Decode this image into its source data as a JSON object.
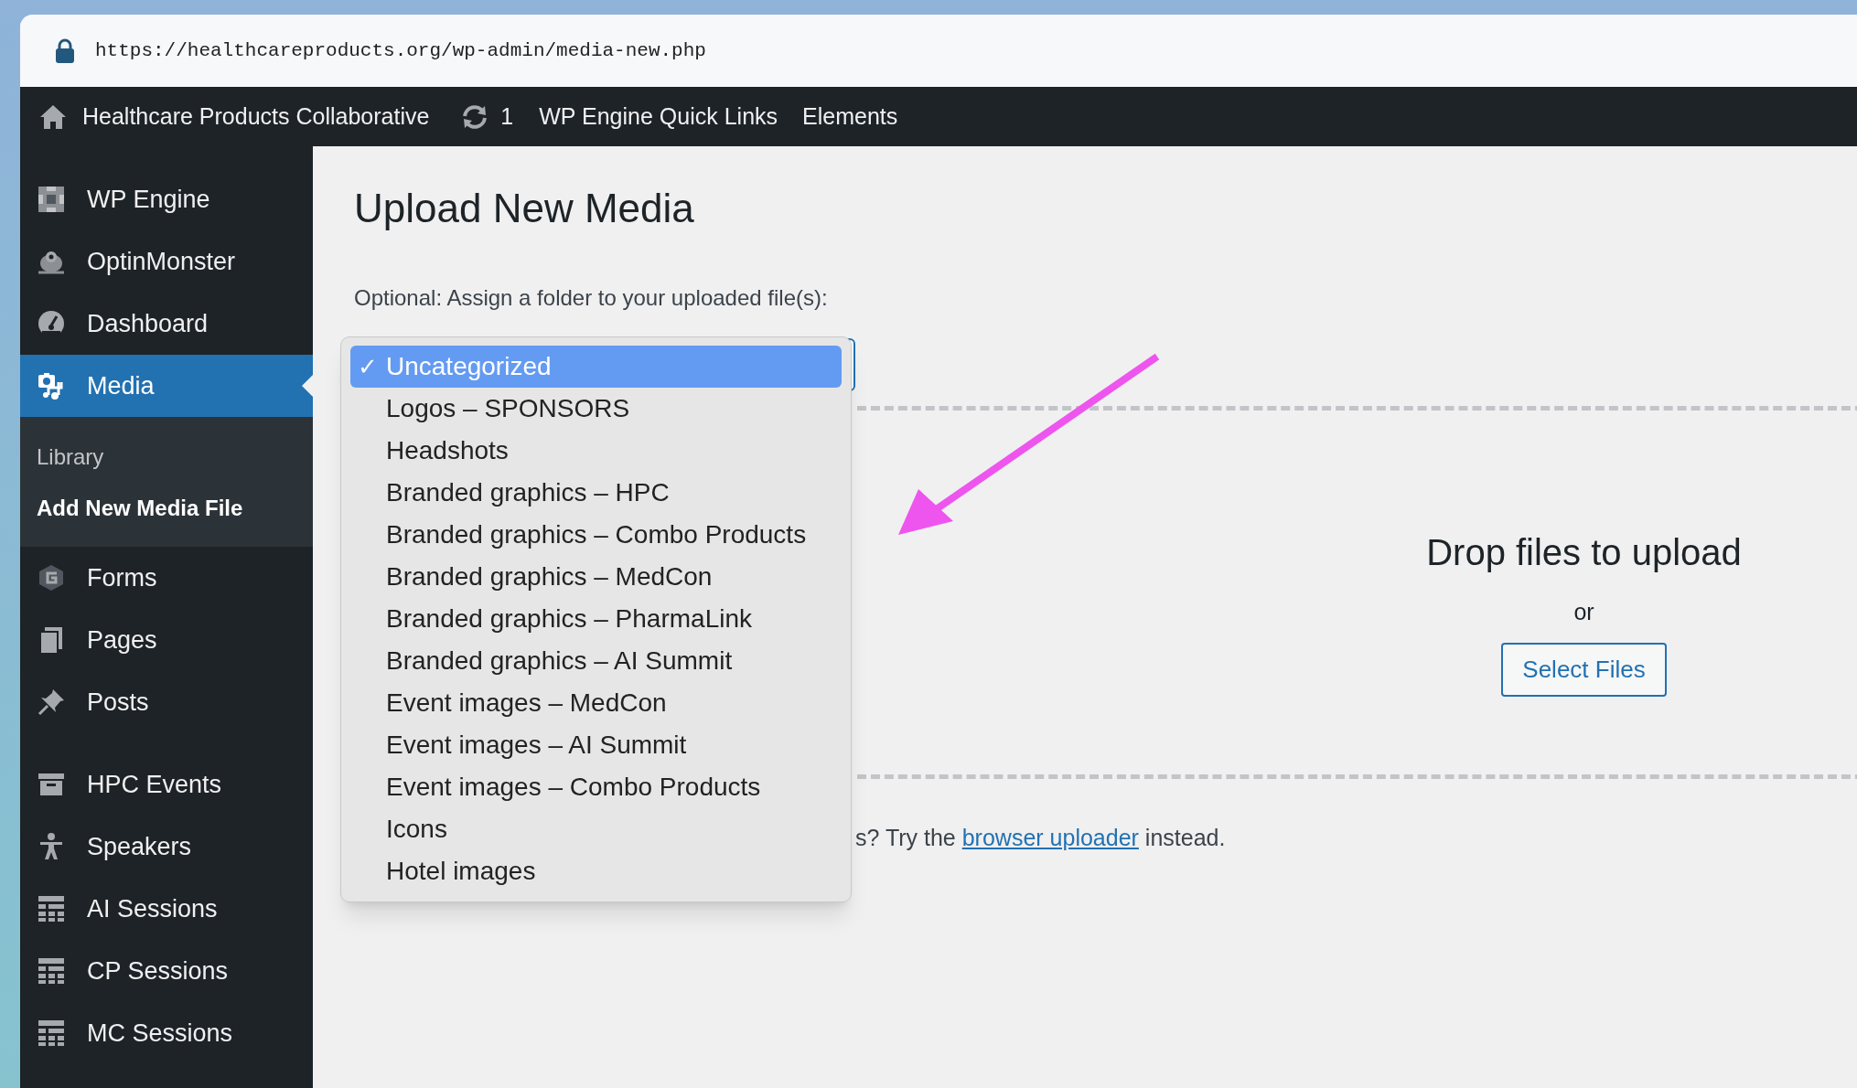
{
  "browser": {
    "url": "https://healthcareproducts.org/wp-admin/media-new.php"
  },
  "admin_bar": {
    "site_name": "Healthcare Products Collaborative",
    "updates_count": "1",
    "links": [
      "WP Engine Quick Links",
      "Elements"
    ]
  },
  "sidebar": {
    "groups": [
      [
        {
          "label": "WP Engine",
          "selected": false
        },
        {
          "label": "OptinMonster",
          "selected": false
        },
        {
          "label": "Dashboard",
          "selected": false
        },
        {
          "label": "Media",
          "selected": true,
          "children": [
            {
              "label": "Library",
              "selected": false
            },
            {
              "label": "Add New Media File",
              "selected": true
            }
          ]
        },
        {
          "label": "Forms",
          "selected": false
        },
        {
          "label": "Pages",
          "selected": false
        },
        {
          "label": "Posts",
          "selected": false
        }
      ],
      [
        {
          "label": "HPC Events",
          "selected": false
        },
        {
          "label": "Speakers",
          "selected": false
        },
        {
          "label": "AI Sessions",
          "selected": false
        },
        {
          "label": "CP Sessions",
          "selected": false
        },
        {
          "label": "MC Sessions",
          "selected": false
        }
      ]
    ]
  },
  "page": {
    "title": "Upload New Media",
    "folder_prompt": "Optional: Assign a folder to your uploaded file(s):",
    "folder_select": {
      "expanded": true,
      "check_mark": "✓",
      "options": [
        {
          "label": "Uncategorized",
          "selected": true
        },
        {
          "label": "Logos – SPONSORS",
          "selected": false
        },
        {
          "label": "Headshots",
          "selected": false
        },
        {
          "label": "Branded graphics – HPC",
          "selected": false
        },
        {
          "label": "Branded graphics – Combo Products",
          "selected": false
        },
        {
          "label": "Branded graphics – MedCon",
          "selected": false
        },
        {
          "label": "Branded graphics – PharmaLink",
          "selected": false
        },
        {
          "label": "Branded graphics – AI Summit",
          "selected": false
        },
        {
          "label": "Event images – MedCon",
          "selected": false
        },
        {
          "label": "Event images – AI Summit",
          "selected": false
        },
        {
          "label": "Event images – Combo Products",
          "selected": false
        },
        {
          "label": "Icons",
          "selected": false
        },
        {
          "label": "Hotel images",
          "selected": false
        }
      ]
    },
    "upload": {
      "drop_text": "Drop files to upload",
      "or_text": "or",
      "button": "Select Files"
    },
    "help": {
      "before": "s? Try the",
      "link": "browser uploader",
      "after": "instead."
    }
  }
}
